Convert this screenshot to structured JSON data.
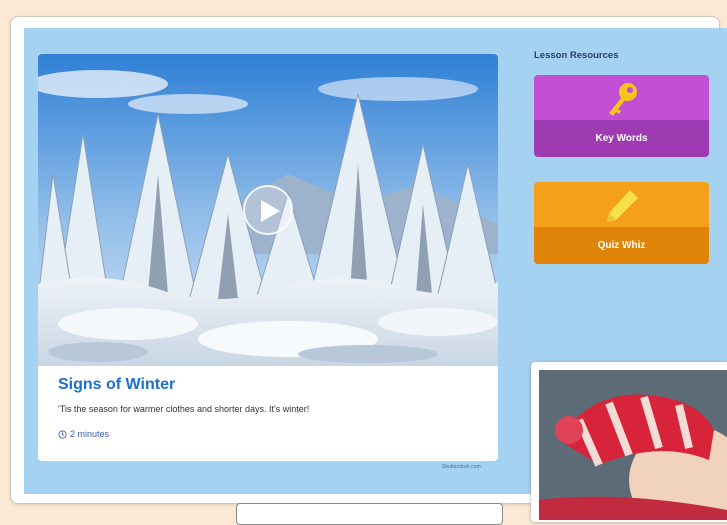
{
  "resources": {
    "heading": "Lesson Resources",
    "items": [
      {
        "label": "Key Words",
        "icon": "key-icon",
        "color_top": "#c24fd4",
        "color_bottom": "#9f3bb2"
      },
      {
        "label": "Quiz Whiz",
        "icon": "pencil-icon",
        "color_top": "#f5a01b",
        "color_bottom": "#e08409"
      }
    ]
  },
  "video": {
    "title": "Signs of Winter",
    "description": "'Tis the season for warmer clothes and shorter days. It's winter!",
    "duration": "2 minutes",
    "duration_icon": "clock-icon",
    "credit": "Shutterstock.com"
  },
  "colors": {
    "page_background": "#fbe9d6",
    "stage": "#a6d2f2",
    "title_blue": "#1b6fd0"
  }
}
